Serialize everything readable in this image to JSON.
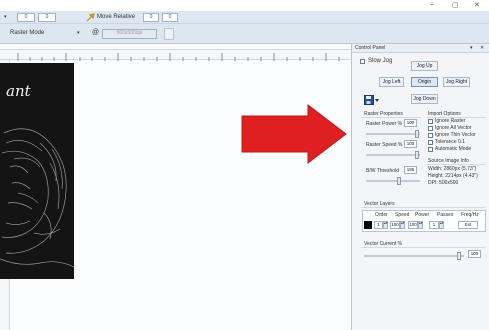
{
  "window": {
    "minimize_glyph": "–",
    "maximize_glyph": "▢",
    "close_glyph": "✕"
  },
  "toolbar1": {
    "field1_value": "0",
    "field2_value": "0",
    "move_relative_label": "Move Relative",
    "field3_value": "0",
    "field4_value": "0"
  },
  "toolbar2": {
    "mode_label": "Raster Mode",
    "at_symbol": "@",
    "dpi_value": "500x500dpi"
  },
  "canvas": {
    "engraving_text": "ant"
  },
  "control_panel": {
    "title": "Control Panel",
    "pin_glyph": "▾",
    "close_glyph": "✕",
    "slow_jog_label": "Slow Jog",
    "jog_up": "Jog Up",
    "jog_left": "Jog Left",
    "origin": "Origin",
    "jog_right": "Jog Right",
    "jog_down": "Jog Down",
    "raster_properties_label": "Raster Properties",
    "raster_power_label": "Raster Power %",
    "raster_power_value": "100",
    "raster_speed_label": "Raster Speed %",
    "raster_speed_value": "100",
    "bw_threshold_label": "B/W Threshold",
    "bw_threshold_value": "185",
    "import_options_label": "Import Options",
    "ignore_raster": "Ignore Raster",
    "ignore_all_vector": "Ignore All Vector",
    "ignore_thin_vector": "Ignore Thin Vector",
    "tolerance": "Tolerance 0.1",
    "automatic_mode": "Automatic Mode",
    "source_image_info_label": "Source Image Info",
    "width_info": "Width: 2860px (5.73\")",
    "height_info": "Height: 2214px (4.43\")",
    "dpi_info": "DPI: 500x500",
    "vector_layers_label": "Vector Layers",
    "vector_columns": [
      "Order",
      "Speed",
      "Power",
      "Passes",
      "Freq/Hz"
    ],
    "vector_row": {
      "order": "1",
      "speed": "100",
      "power": "100",
      "passes": "1",
      "freq": "Ext"
    },
    "vector_current_label": "Vector Current %",
    "vector_current_value": "100"
  },
  "annotation": {
    "arrow_color": "#e02020"
  }
}
